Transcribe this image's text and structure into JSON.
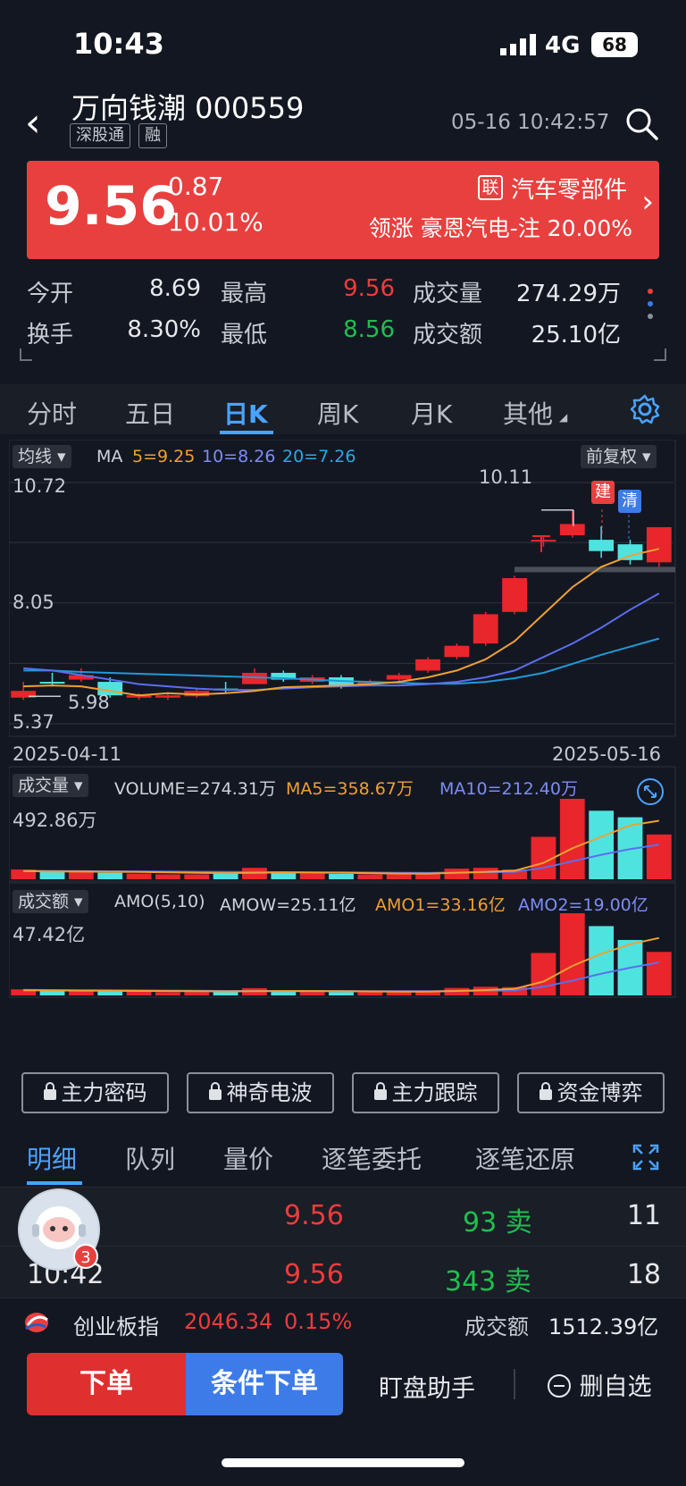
{
  "status": {
    "time": "10:43",
    "network": "4G",
    "battery": "68"
  },
  "header": {
    "name": "万向钱潮 000559",
    "tags": [
      "深股通",
      "融"
    ],
    "timestamp": "05-16 10:42:57"
  },
  "quote": {
    "price": "9.56",
    "change": "0.87",
    "change_pct": "10.01%",
    "sector_tag": "联",
    "sector": "汽车零部件",
    "lead_label": "领涨",
    "lead_stock": "豪恩汽电-注",
    "lead_pct": "20.00%"
  },
  "stats": {
    "open_label": "今开",
    "open": "8.69",
    "high_label": "最高",
    "high": "9.56",
    "vol_label": "成交量",
    "vol": "274.29万",
    "turnover_label": "换手",
    "turnover": "8.30%",
    "low_label": "最低",
    "low": "8.56",
    "amt_label": "成交额",
    "amt": "25.10亿"
  },
  "tabs": [
    "分时",
    "五日",
    "日K",
    "周K",
    "月K",
    "其他"
  ],
  "chart": {
    "ma_dropdown": "均线",
    "ma_label": "MA",
    "ma5": "5=9.25",
    "ma10": "10=8.26",
    "ma20": "20=7.26",
    "adjust": "前复权",
    "y_top": "10.72",
    "y_mid": "8.05",
    "y_bot": "5.37",
    "max_label": "10.11",
    "min_label": "5.98",
    "badge_build": "建",
    "badge_clear": "清",
    "date_start": "2025-04-11",
    "date_end": "2025-05-16",
    "vol_dropdown": "成交量",
    "vol_line": "VOLUME=274.31万",
    "vol_ma5": "MA5=358.67万",
    "vol_ma10": "MA10=212.40万",
    "vol_max": "492.86万",
    "amo_dropdown": "成交额",
    "amo_params": "AMO(5,10)",
    "amow": "AMOW=25.11亿",
    "amo1": "AMO1=33.16亿",
    "amo2": "AMO2=19.00亿",
    "amo_max": "47.42亿",
    "colors": {
      "up": "#e8262b",
      "down": "#4fe3e0",
      "ma5": "#f0a030",
      "ma10": "#5b6ef0",
      "ma20": "#1e9ad8"
    }
  },
  "chart_data": {
    "type": "candlestick",
    "x_start": "2025-04-11",
    "x_end": "2025-05-16",
    "ylim": [
      5.37,
      10.72
    ],
    "candles": [
      {
        "o": 5.95,
        "c": 6.1,
        "h": 6.3,
        "l": 5.9,
        "up": true
      },
      {
        "o": 6.3,
        "c": 6.3,
        "h": 6.5,
        "l": 6.2,
        "up": false
      },
      {
        "o": 6.35,
        "c": 6.45,
        "h": 6.6,
        "l": 6.3,
        "up": true
      },
      {
        "o": 6.3,
        "c": 6.0,
        "h": 6.4,
        "l": 5.95,
        "up": false
      },
      {
        "o": 5.95,
        "c": 6.0,
        "h": 6.05,
        "l": 5.9,
        "up": true
      },
      {
        "o": 5.95,
        "c": 6.0,
        "h": 6.05,
        "l": 5.9,
        "up": true
      },
      {
        "o": 5.98,
        "c": 6.1,
        "h": 6.15,
        "l": 5.95,
        "up": true
      },
      {
        "o": 6.15,
        "c": 6.15,
        "h": 6.3,
        "l": 6.05,
        "up": false
      },
      {
        "o": 6.25,
        "c": 6.5,
        "h": 6.6,
        "l": 6.25,
        "up": true
      },
      {
        "o": 6.5,
        "c": 6.35,
        "h": 6.55,
        "l": 6.3,
        "up": false
      },
      {
        "o": 6.3,
        "c": 6.4,
        "h": 6.45,
        "l": 6.25,
        "up": true
      },
      {
        "o": 6.4,
        "c": 6.2,
        "h": 6.45,
        "l": 6.15,
        "up": false
      },
      {
        "o": 6.25,
        "c": 6.3,
        "h": 6.35,
        "l": 6.2,
        "up": true
      },
      {
        "o": 6.35,
        "c": 6.45,
        "h": 6.5,
        "l": 6.3,
        "up": true
      },
      {
        "o": 6.55,
        "c": 6.8,
        "h": 6.85,
        "l": 6.5,
        "up": true
      },
      {
        "o": 6.85,
        "c": 7.1,
        "h": 7.15,
        "l": 6.8,
        "up": true
      },
      {
        "o": 7.15,
        "c": 7.8,
        "h": 7.85,
        "l": 7.1,
        "up": true
      },
      {
        "o": 7.85,
        "c": 8.6,
        "h": 8.65,
        "l": 7.8,
        "up": true
      },
      {
        "o": 9.45,
        "c": 9.45,
        "h": 9.55,
        "l": 9.3,
        "up": true
      },
      {
        "o": 9.55,
        "c": 9.8,
        "h": 10.11,
        "l": 9.5,
        "up": true
      },
      {
        "o": 9.45,
        "c": 9.2,
        "h": 9.75,
        "l": 9.05,
        "up": false
      },
      {
        "o": 9.35,
        "c": 9.0,
        "h": 9.45,
        "l": 8.9,
        "up": false
      },
      {
        "o": 8.95,
        "c": 9.73,
        "h": 9.73,
        "l": 8.8,
        "up": true
      }
    ],
    "ma5": [
      6.2,
      6.22,
      6.2,
      6.1,
      6.0,
      6.05,
      6.02,
      6.05,
      6.1,
      6.18,
      6.2,
      6.22,
      6.25,
      6.3,
      6.4,
      6.55,
      6.8,
      7.2,
      7.8,
      8.4,
      8.85,
      9.1,
      9.25
    ],
    "ma10": [
      6.6,
      6.55,
      6.45,
      6.35,
      6.25,
      6.2,
      6.15,
      6.12,
      6.12,
      6.15,
      6.18,
      6.2,
      6.22,
      6.22,
      6.25,
      6.3,
      6.4,
      6.55,
      6.85,
      7.15,
      7.5,
      7.9,
      8.26
    ],
    "ma20": [
      6.55,
      6.55,
      6.52,
      6.5,
      6.48,
      6.46,
      6.44,
      6.42,
      6.4,
      6.38,
      6.35,
      6.32,
      6.3,
      6.28,
      6.26,
      6.26,
      6.3,
      6.38,
      6.5,
      6.7,
      6.9,
      7.08,
      7.26
    ],
    "volume": [
      60,
      45,
      55,
      40,
      35,
      30,
      30,
      35,
      70,
      38,
      35,
      33,
      30,
      32,
      40,
      65,
      70,
      60,
      260,
      492.86,
      420,
      380,
      274.31
    ],
    "volume_ma5": [
      50,
      48,
      47,
      46,
      45,
      42,
      40,
      38,
      40,
      42,
      41,
      40,
      38,
      35,
      34,
      40,
      45,
      52,
      100,
      190,
      260,
      330,
      358.67
    ],
    "volume_ma10": [
      52,
      51,
      50,
      49,
      48,
      47,
      46,
      45,
      44,
      43,
      42,
      42,
      41,
      40,
      39,
      41,
      43,
      45,
      70,
      110,
      150,
      185,
      212.4
    ],
    "amount": [
      3.5,
      2.8,
      3.3,
      2.5,
      2.1,
      1.9,
      2.0,
      2.2,
      4.2,
      2.4,
      2.2,
      2.0,
      1.9,
      2.0,
      2.6,
      4.3,
      5.0,
      4.8,
      24.5,
      47.42,
      40,
      32,
      25.11
    ],
    "amount_ma1": [
      3.0,
      2.9,
      2.8,
      2.7,
      2.6,
      2.5,
      2.4,
      2.3,
      2.4,
      2.5,
      2.5,
      2.4,
      2.3,
      2.2,
      2.2,
      2.6,
      3.1,
      3.8,
      8.0,
      17.0,
      24.0,
      29.5,
      33.16
    ],
    "amount_ma2": [
      3.2,
      3.1,
      3.0,
      2.95,
      2.9,
      2.8,
      2.7,
      2.6,
      2.6,
      2.55,
      2.5,
      2.5,
      2.45,
      2.4,
      2.4,
      2.5,
      2.65,
      2.9,
      5.0,
      8.5,
      12.5,
      16.0,
      19.0
    ]
  },
  "features": [
    "主力密码",
    "神奇电波",
    "主力跟踪",
    "资金博弈"
  ],
  "detail_tabs": [
    "明细",
    "队列",
    "量价",
    "逐笔委托",
    "逐笔还原"
  ],
  "trades": [
    {
      "time": "",
      "price": "9.56",
      "vol": "93",
      "side": "卖",
      "count": "11"
    },
    {
      "time": "10:42",
      "price": "9.56",
      "vol": "343",
      "side": "卖",
      "count": "18"
    }
  ],
  "avatar_badge": "3",
  "index": {
    "name": "创业板指",
    "value": "2046.34",
    "pct": "0.15%",
    "amt_label": "成交额",
    "amt": "1512.39亿"
  },
  "bottom": {
    "order": "下单",
    "cond_order": "条件下单",
    "monitor": "盯盘助手",
    "remove": "删自选"
  }
}
